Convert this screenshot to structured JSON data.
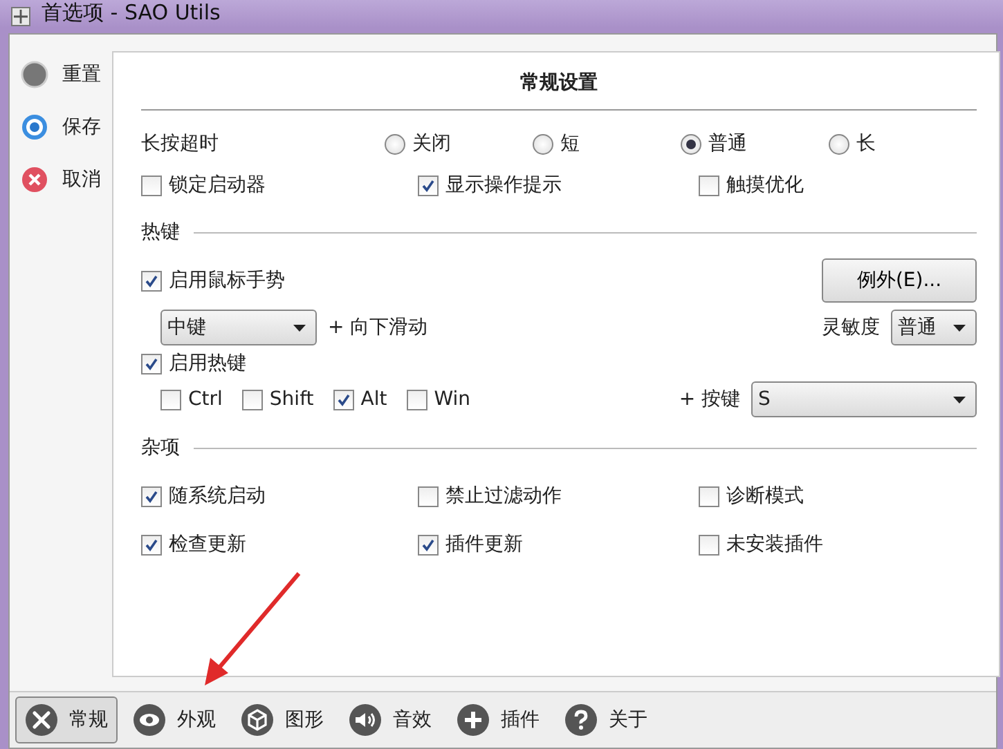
{
  "window": {
    "title": "首选项 - SAO Utils"
  },
  "side_actions": [
    {
      "label": "重置",
      "kind": "reset"
    },
    {
      "label": "保存",
      "kind": "save"
    },
    {
      "label": "取消",
      "kind": "cancel"
    }
  ],
  "panel": {
    "title": "常规设置",
    "long_press": {
      "label": "长按超时",
      "options": [
        {
          "label": "关闭",
          "selected": false
        },
        {
          "label": "短",
          "selected": false
        },
        {
          "label": "普通",
          "selected": true
        },
        {
          "label": "长",
          "selected": false
        }
      ]
    },
    "general_checks": [
      {
        "label": "锁定启动器",
        "checked": false
      },
      {
        "label": "显示操作提示",
        "checked": true
      },
      {
        "label": "触摸优化",
        "checked": false
      }
    ],
    "hotkeys": {
      "title": "热键",
      "gesture": {
        "label": "启用鼠标手势",
        "checked": true
      },
      "exceptions_button": "例外(E)...",
      "mouse_button": "中键",
      "gesture_suffix": "+ 向下滑动",
      "sensitivity_label": "灵敏度",
      "sensitivity": "普通",
      "hotkey": {
        "label": "启用热键",
        "checked": true
      },
      "modifiers": [
        {
          "label": "Ctrl",
          "checked": false
        },
        {
          "label": "Shift",
          "checked": false
        },
        {
          "label": "Alt",
          "checked": true
        },
        {
          "label": "Win",
          "checked": false
        }
      ],
      "key_label": "+ 按键",
      "key": "S"
    },
    "misc": {
      "title": "杂项",
      "checks": [
        {
          "label": "随系统启动",
          "checked": true
        },
        {
          "label": "禁止过滤动作",
          "checked": false
        },
        {
          "label": "诊断模式",
          "checked": false
        },
        {
          "label": "检查更新",
          "checked": true
        },
        {
          "label": "插件更新",
          "checked": true
        },
        {
          "label": "未安装插件",
          "checked": false
        }
      ]
    }
  },
  "tabs": [
    {
      "label": "常规",
      "kind": "tools",
      "selected": true
    },
    {
      "label": "外观",
      "kind": "eye",
      "selected": false
    },
    {
      "label": "图形",
      "kind": "cube",
      "selected": false
    },
    {
      "label": "音效",
      "kind": "speaker",
      "selected": false
    },
    {
      "label": "插件",
      "kind": "plus",
      "selected": false
    },
    {
      "label": "关于",
      "kind": "help",
      "selected": false
    }
  ]
}
